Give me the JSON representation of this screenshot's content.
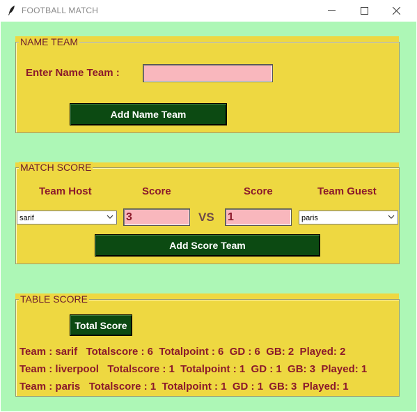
{
  "window": {
    "title": "FOOTBALL MATCH",
    "icon": "feather-icon",
    "controls": {
      "minimize": "minimize-icon",
      "maximize": "maximize-icon",
      "close": "close-icon"
    }
  },
  "colors": {
    "background": "#adf7b6",
    "frame": "#eed841",
    "label": "#8b1a2b",
    "entry": "#f9b7bd",
    "button": "#0c4a12"
  },
  "name_team": {
    "legend": "NAME TEAM",
    "label": "Enter Name Team :",
    "input_value": "",
    "button": "Add Name Team"
  },
  "match_score": {
    "legend": "MATCH SCORE",
    "header_host": "Team Host",
    "header_score_host": "Score",
    "header_score_guest": "Score",
    "header_guest": "Team Guest",
    "host_team": "sarif",
    "host_score": "3",
    "vs": "VS",
    "guest_score": "1",
    "guest_team": "paris",
    "button": "Add Score Team"
  },
  "table_score": {
    "legend": "TABLE SCORE",
    "button": "Total Score",
    "rows": [
      "Team : sarif   Totalscore : 6  Totalpoint : 6  GD : 6  GB: 2  Played: 2",
      "Team : liverpool   Totalscore : 1  Totalpoint : 1  GD : 1  GB: 3  Played: 1",
      "Team : paris   Totalscore : 1  Totalpoint : 1  GD : 1  GB: 3  Played: 1"
    ]
  }
}
